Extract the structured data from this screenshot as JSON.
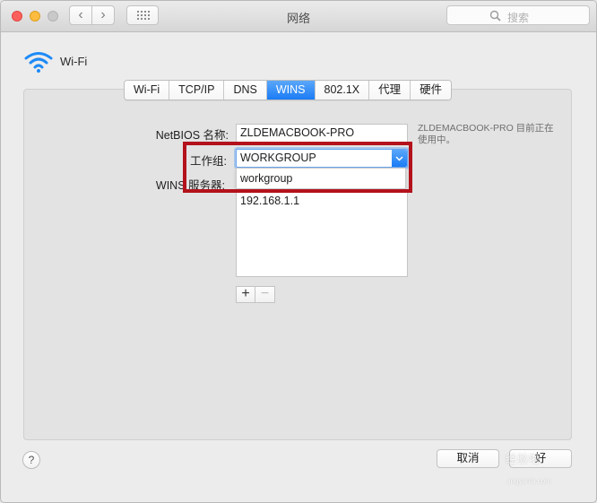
{
  "window": {
    "title": "网络",
    "search_placeholder": "搜索"
  },
  "interface": {
    "name": "Wi-Fi"
  },
  "tabs": [
    {
      "label": "Wi-Fi",
      "active": false
    },
    {
      "label": "TCP/IP",
      "active": false
    },
    {
      "label": "DNS",
      "active": false
    },
    {
      "label": "WINS",
      "active": true
    },
    {
      "label": "802.1X",
      "active": false
    },
    {
      "label": "代理",
      "active": false
    },
    {
      "label": "硬件",
      "active": false
    }
  ],
  "form": {
    "netbios_label": "NetBIOS 名称:",
    "netbios_value": "ZLDEMACBOOK-PRO",
    "status_note": "ZLDEMACBOOK-PRO 目前正在使用中。",
    "workgroup_label": "工作组:",
    "workgroup_value": "WORKGROUP",
    "workgroup_suggestion": "workgroup",
    "wins_label": "WINS 服务器:",
    "wins_servers": [
      "192.168.1.1"
    ],
    "add_label": "+",
    "remove_label": "−"
  },
  "footer": {
    "help_label": "?",
    "cancel_label": "取消",
    "ok_label": "好"
  },
  "watermark": {
    "text": "经验啦",
    "url": "jingyanla.com"
  },
  "colors": {
    "accent": "#1b7cf5",
    "highlight": "#b3121c",
    "wifi": "#1d8af6"
  }
}
